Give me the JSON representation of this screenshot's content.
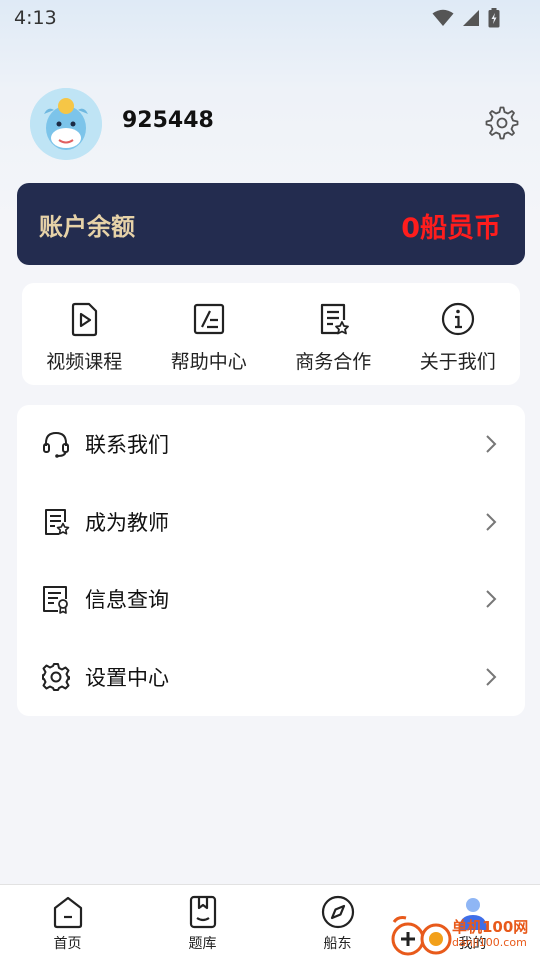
{
  "status_bar": {
    "time": "4:13"
  },
  "profile": {
    "username": "925448"
  },
  "balance": {
    "label": "账户余额",
    "value": "0船员币",
    "accent": "#ff1d1d",
    "card_bg": "#232c4f"
  },
  "shortcuts": [
    {
      "label": "视频课程",
      "icon": "video-file-icon"
    },
    {
      "label": "帮助中心",
      "icon": "edit-note-icon"
    },
    {
      "label": "商务合作",
      "icon": "document-star-icon"
    },
    {
      "label": "关于我们",
      "icon": "info-icon"
    }
  ],
  "menu": [
    {
      "label": "联系我们",
      "icon": "headset-icon"
    },
    {
      "label": "成为教师",
      "icon": "document-star-icon"
    },
    {
      "label": "信息查询",
      "icon": "certificate-icon"
    },
    {
      "label": "设置中心",
      "icon": "gear-icon"
    }
  ],
  "bottom_nav": [
    {
      "label": "首页",
      "icon": "home-icon"
    },
    {
      "label": "题库",
      "icon": "bookmark-book-icon"
    },
    {
      "label": "船东",
      "icon": "compass-icon"
    },
    {
      "label": "我的",
      "icon": "person-icon",
      "active": true
    }
  ],
  "watermark": {
    "text": "单机100网",
    "sub": "danji100.com"
  }
}
